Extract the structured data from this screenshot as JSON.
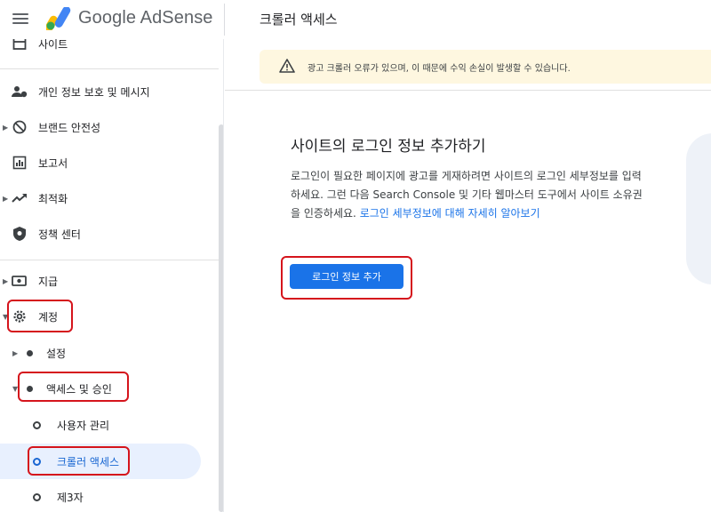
{
  "header": {
    "brand": "Google AdSense",
    "page_title": "크롤러 액세스"
  },
  "sidebar": {
    "items": [
      {
        "label": "사이트"
      },
      {
        "label": "개인 정보 보호 및 메시지"
      },
      {
        "label": "브랜드 안전성"
      },
      {
        "label": "보고서"
      },
      {
        "label": "최적화"
      },
      {
        "label": "정책 센터"
      },
      {
        "label": "지급"
      },
      {
        "label": "계정"
      },
      {
        "label": "설정"
      },
      {
        "label": "액세스 및 승인"
      },
      {
        "label": "사용자 관리"
      },
      {
        "label": "크롤러 액세스"
      },
      {
        "label": "제3자"
      }
    ]
  },
  "main": {
    "warning": "광고 크롤러 오류가 있으며, 이 때문에 수익 손실이 발생할 수 있습니다.",
    "card_title": "사이트의 로그인 정보 추가하기",
    "card_desc": "로그인이 필요한 페이지에 광고를 게재하려면 사이트의 로그인 세부정보를 입력하세요. 그런 다음 Search Console 및 기타 웹마스터 도구에서 사이트 소유권을 인증하세요.",
    "learn_more": "로그인 세부정보에 대해 자세히 알아보기",
    "add_button": "로그인 정보 추가"
  },
  "colors": {
    "accent": "#1a73e8",
    "active_bg": "#e8f0fe",
    "highlight": "#d5141c",
    "warning_bg": "#fef7e0"
  }
}
